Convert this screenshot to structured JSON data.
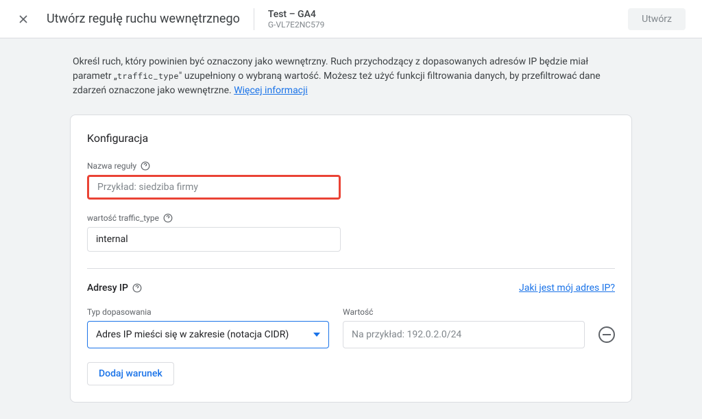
{
  "header": {
    "title": "Utwórz regułę ruchu wewnętrznego",
    "property_name": "Test – GA4",
    "property_id": "G-VL7E2NC579",
    "create_button": "Utwórz"
  },
  "description": {
    "text_before": "Określ ruch, który powinien być oznaczony jako wewnętrzny. Ruch przychodzący z dopasowanych adresów IP będzie miał parametr „",
    "code": "traffic_type",
    "text_after": "\" uzupełniony o wybraną wartość. Możesz też użyć funkcji filtrowania danych, by przefiltrować dane zdarzeń oznaczone jako wewnętrzne. ",
    "learn_more": "Więcej informacji"
  },
  "config": {
    "title": "Konfiguracja",
    "rule_name_label": "Nazwa reguły",
    "rule_name_placeholder": "Przykład: siedziba firmy",
    "traffic_type_label": "wartość traffic_type",
    "traffic_type_value": "internal"
  },
  "ip": {
    "title": "Adresy IP",
    "my_ip_link": "Jaki jest mój adres IP?",
    "match_type_label": "Typ dopasowania",
    "match_type_value": "Adres IP mieści się w zakresie (notacja CIDR)",
    "value_label": "Wartość",
    "value_placeholder": "Na przykład: 192.0.2.0/24",
    "add_condition": "Dodaj warunek"
  }
}
